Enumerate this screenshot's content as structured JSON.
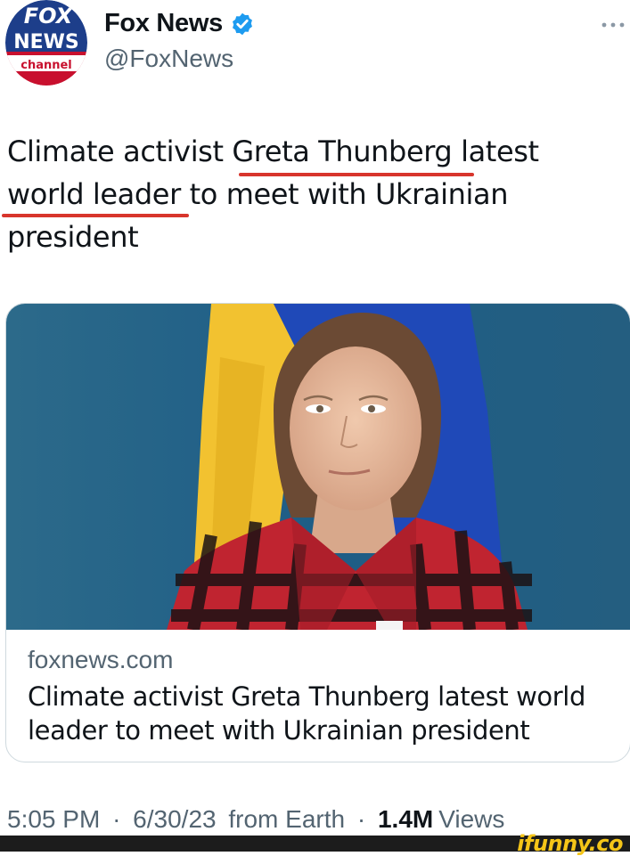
{
  "author": {
    "display_name": "Fox News",
    "handle": "@FoxNews",
    "verified": true,
    "avatar_logo_text": [
      "FOX",
      "NEWS",
      "channel"
    ],
    "avatar_colors": {
      "top": "#1d3e8a",
      "bottom": "#c8102e"
    }
  },
  "tweet": {
    "lines": [
      "Climate activist Greta Thunberg latest",
      "world leader to meet with Ukrainian",
      "president"
    ],
    "underline_color": "#d8352c"
  },
  "link_card": {
    "domain": "foxnews.com",
    "title_lines": [
      "Climate activist Greta Thunberg latest world",
      "leader to meet with Ukrainian president"
    ],
    "image_description_icon": "photo-image"
  },
  "meta": {
    "time": "5:05 PM",
    "separator": "·",
    "date": "6/30/23",
    "source": "from Earth",
    "view_count": "1.4M",
    "views_label": "Views"
  },
  "watermark": {
    "text": "ifunny.co"
  },
  "colors": {
    "text_primary": "#0f1419",
    "text_secondary": "#536471",
    "verified_blue": "#1d9bf0",
    "card_border": "#cfd9de"
  }
}
